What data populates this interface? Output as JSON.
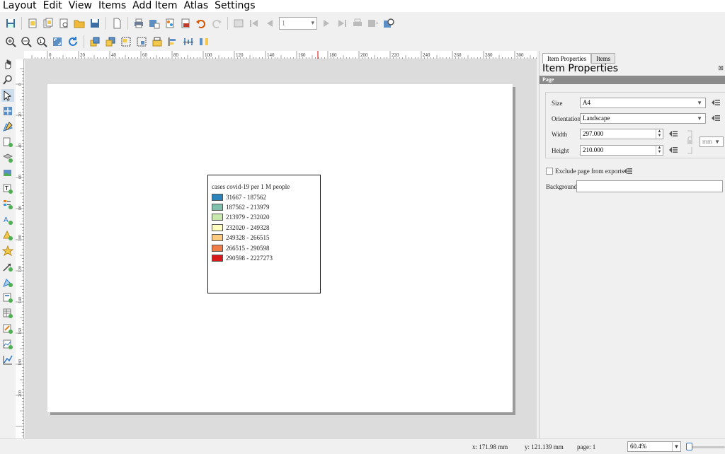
{
  "menu": [
    "Layout",
    "Edit",
    "View",
    "Items",
    "Add Item",
    "Atlas",
    "Settings"
  ],
  "toolbar": {
    "atlas_page_value": "1"
  },
  "ruler": {
    "h_labels": [
      "0",
      "20",
      "40",
      "60",
      "80",
      "100",
      "120",
      "140",
      "160",
      "180",
      "200",
      "220",
      "240",
      "260",
      "280",
      "300"
    ],
    "v_labels": [
      "0",
      "20",
      "40",
      "60",
      "80",
      "100",
      "120",
      "140",
      "160",
      "180",
      "200"
    ]
  },
  "legend": {
    "title": "cases covid-19 per 1 M people",
    "items": [
      {
        "label": "31667 - 187562",
        "color": "#2b83ba"
      },
      {
        "label": "187562 - 213979",
        "color": "#80bfac"
      },
      {
        "label": "213979 - 232020",
        "color": "#c7e9ad"
      },
      {
        "label": "232020 - 249328",
        "color": "#ffffbf"
      },
      {
        "label": "249328 - 266515",
        "color": "#fec980"
      },
      {
        "label": "266515 - 290598",
        "color": "#f07c4a"
      },
      {
        "label": "290598 - 2227273",
        "color": "#d7191c"
      }
    ]
  },
  "dock": {
    "tabs": [
      "Item Properties",
      "Items"
    ],
    "title": "Item Properties",
    "section": "Page",
    "size_label": "Size",
    "size_value": "A4",
    "orientation_label": "Orientation",
    "orientation_value": "Landscape",
    "width_label": "Width",
    "width_value": "297.000",
    "height_label": "Height",
    "height_value": "210.000",
    "unit_value": "mm",
    "exclude_label": "Exclude page from exports",
    "background_label": "Background"
  },
  "status": {
    "x": "x: 171.98 mm",
    "y": "y: 121.139 mm",
    "page": "page: 1",
    "zoom": "60.4%"
  },
  "colors": {
    "accent": "#2a7ad0",
    "canvas_bg": "#dcdcdc",
    "page_shadow": "#9a9a9a"
  }
}
